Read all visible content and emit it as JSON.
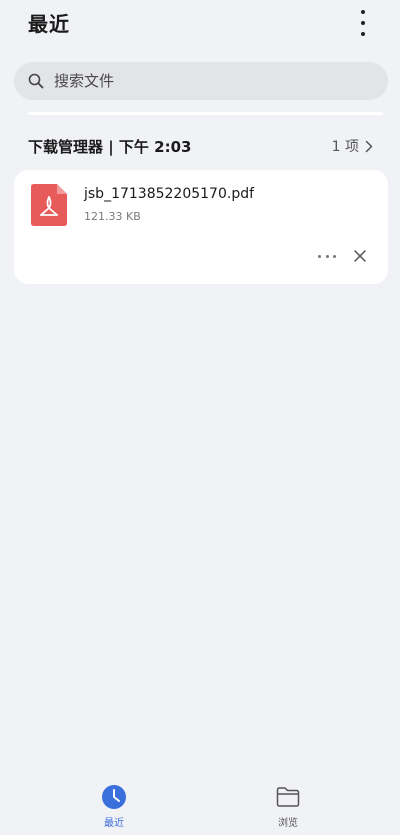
{
  "header": {
    "title": "最近",
    "more_icon": "more-vertical-icon"
  },
  "search": {
    "placeholder": "搜索文件",
    "icon": "search-icon"
  },
  "group": {
    "title": "下载管理器 | 下午 2:03",
    "count": "1 项",
    "chevron_icon": "chevron-right-icon"
  },
  "files": [
    {
      "name": "jsb_1713852205170.pdf",
      "size": "121.33 KB",
      "icon": "pdf-file-icon",
      "icon_color": "#e85b5b"
    }
  ],
  "bottom_nav": {
    "items": [
      {
        "label": "最近",
        "icon": "clock-icon",
        "active": true,
        "color": "#3a6fdc"
      },
      {
        "label": "浏览",
        "icon": "folder-icon",
        "active": false,
        "color": "#555555"
      }
    ]
  }
}
